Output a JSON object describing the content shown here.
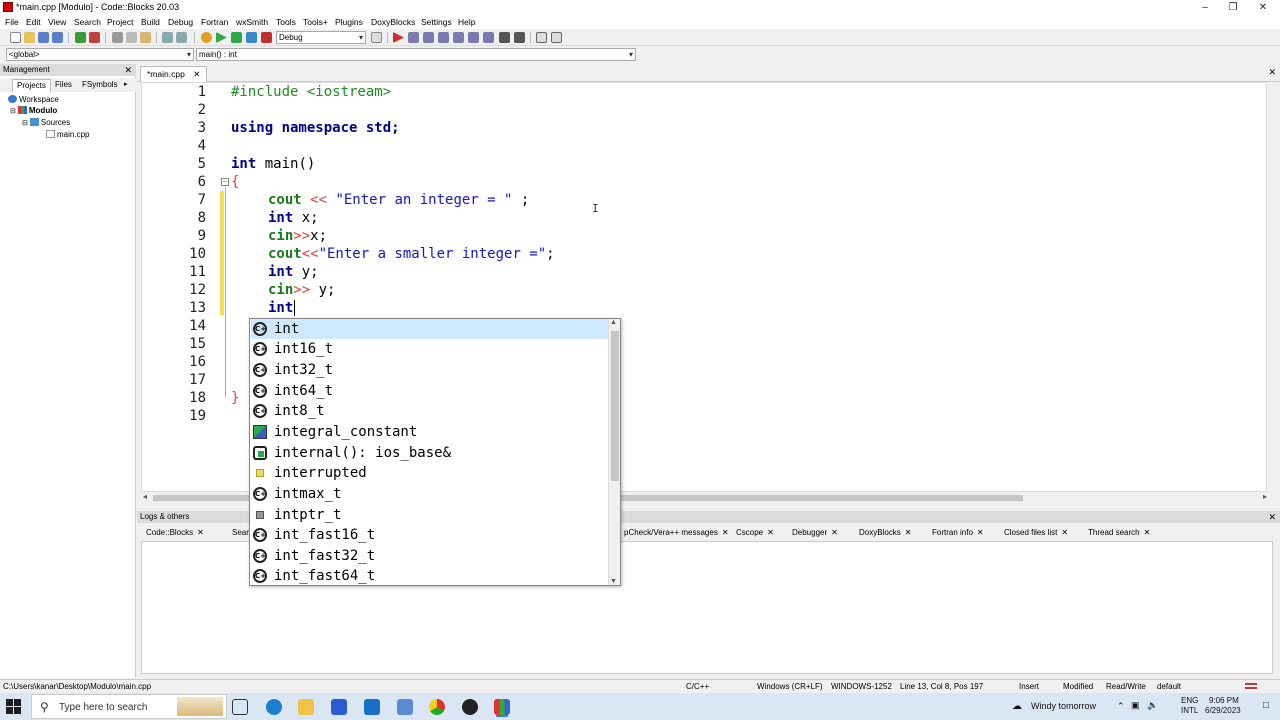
{
  "window": {
    "title": "*main.cpp [Modulo] - Code::Blocks 20.03"
  },
  "menu": [
    "File",
    "Edit",
    "View",
    "Search",
    "Project",
    "Build",
    "Debug",
    "Fortran",
    "wxSmith",
    "Tools",
    "Tools+",
    "Plugins",
    "DoxyBlocks",
    "Settings",
    "Help"
  ],
  "toolbar": {
    "build_target": "Debug"
  },
  "codebar": {
    "scope": "<global>",
    "function": "main() : int"
  },
  "management": {
    "title": "Management",
    "tabs": [
      "Projects",
      "Files",
      "FSymbols"
    ],
    "tree": {
      "workspace": "Workspace",
      "project": "Modulo",
      "folder": "Sources",
      "file": "main.cpp"
    }
  },
  "editor": {
    "tab_label": "*main.cpp",
    "line_numbers": [
      "1",
      "2",
      "3",
      "4",
      "5",
      "6",
      "7",
      "8",
      "9",
      "10",
      "11",
      "12",
      "13",
      "14",
      "15",
      "16",
      "17",
      "18",
      "19"
    ],
    "code": {
      "l1": "#include <iostream>",
      "l3_kw": "using namespace std;",
      "l5_kw": "int",
      "l5_rest": " main()",
      "l6": "{",
      "l7_kw": "cout",
      "l7_op": " << ",
      "l7_str": "\"Enter an integer = \"",
      "l7_end": " ;",
      "l8_kw": "int",
      "l8_rest": " x;",
      "l9_kw": "cin",
      "l9_op": ">>",
      "l9_rest": "x;",
      "l10_kw": "cout",
      "l10_op": "<<",
      "l10_str": "\"Enter a smaller integer =\"",
      "l10_end": ";",
      "l11_kw": "int",
      "l11_rest": " y;",
      "l12_kw": "cin",
      "l12_op": ">>",
      "l12_rest": " y;",
      "l13_kw": "int",
      "l18": "}"
    }
  },
  "autocomplete": {
    "items": [
      {
        "label": "int",
        "icon": "class"
      },
      {
        "label": "int16_t",
        "icon": "class"
      },
      {
        "label": "int32_t",
        "icon": "class"
      },
      {
        "label": "int64_t",
        "icon": "class"
      },
      {
        "label": "int8_t",
        "icon": "class"
      },
      {
        "label": "integral_constant",
        "icon": "tmpl"
      },
      {
        "label": "internal(): ios_base&",
        "icon": "func"
      },
      {
        "label": "interrupted",
        "icon": "enum"
      },
      {
        "label": "intmax_t",
        "icon": "class"
      },
      {
        "label": "intptr_t",
        "icon": "typedef"
      },
      {
        "label": "int_fast16_t",
        "icon": "class"
      },
      {
        "label": "int_fast32_t",
        "icon": "class"
      },
      {
        "label": "int_fast64_t",
        "icon": "class"
      }
    ],
    "class_glyph": "C+"
  },
  "logs": {
    "title": "Logs & others",
    "tabs": [
      "Code::Blocks",
      "Sear",
      "pCheck/Vera++ messages",
      "Cscope",
      "Debugger",
      "DoxyBlocks",
      "Fortran info",
      "Closed files list",
      "Thread search"
    ]
  },
  "statusbar": {
    "path": "C:\\Users\\kanar\\Desktop\\Modulo\\main.cpp",
    "lang": "C/C++",
    "eol": "Windows (CR+LF)",
    "encoding": "WINDOWS-1252",
    "position": "Line 13, Col 8, Pos 197",
    "mode": "Insert",
    "modified": "Modified",
    "access": "Read/Write",
    "profile": "default"
  },
  "taskbar": {
    "search_placeholder": "Type here to search",
    "weather": "Windy tomorrow",
    "lang1": "ENG",
    "lang2": "INTL",
    "time": "9:06 PM",
    "date": "6/29/2023"
  }
}
